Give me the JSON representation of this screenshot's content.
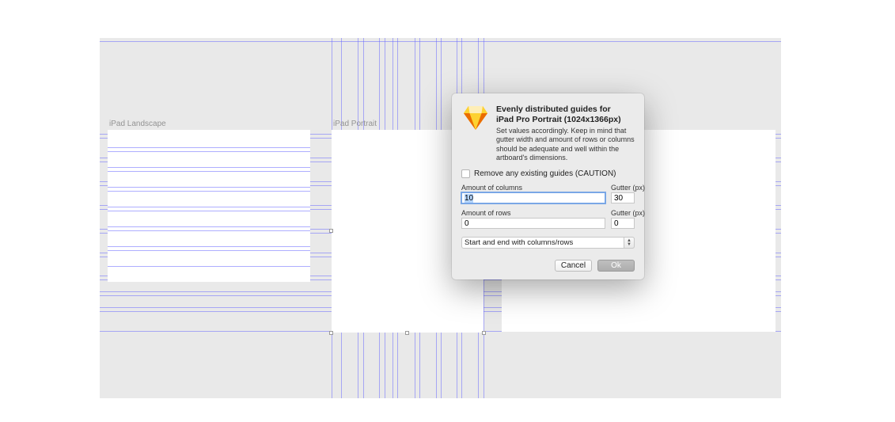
{
  "canvas": {
    "artboards": {
      "landscape": {
        "label": "iPad Landscape"
      },
      "portrait": {
        "label": "iPad Portrait"
      }
    }
  },
  "dialog": {
    "title_line1": "Evenly distributed guides for",
    "title_line2": "iPad Pro Portrait (1024x1366px)",
    "description": "Set values accordingly. Keep in mind that gutter width and amount of rows or columns should be adequate and well within the artboard's dimensions.",
    "remove_label": "Remove any existing guides (CAUTION)",
    "columns_label": "Amount of columns",
    "columns_value": "10",
    "col_gutter_label": "Gutter (px)",
    "col_gutter_value": "30",
    "rows_label": "Amount of rows",
    "rows_value": "0",
    "row_gutter_label": "Gutter (px)",
    "row_gutter_value": "0",
    "select_value": "Start and end with columns/rows",
    "cancel": "Cancel",
    "ok": "Ok"
  }
}
